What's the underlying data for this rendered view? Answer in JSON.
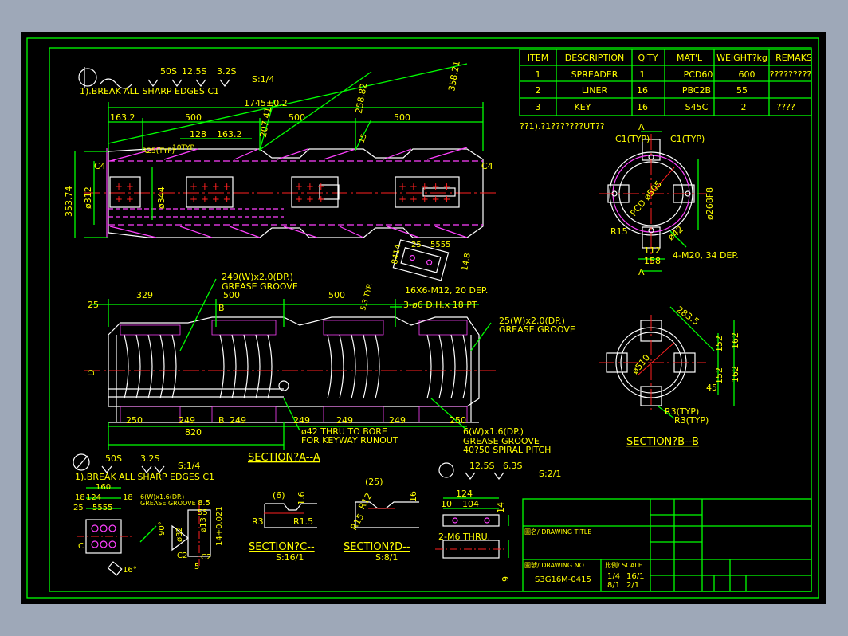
{
  "bom": {
    "headers": [
      "ITEM",
      "DESCRIPTION",
      "Q'TY",
      "MAT'L",
      "WEIGHT?kg",
      "REMAKS"
    ],
    "rows": [
      [
        "1",
        "SPREADER",
        "1",
        "PCD60",
        "600",
        "?????????"
      ],
      [
        "2",
        "LINER",
        "16",
        "PBC2B",
        "55",
        ""
      ],
      [
        "3",
        "KEY",
        "16",
        "S45C",
        "2",
        "????"
      ]
    ]
  },
  "notes": {
    "top_finish": [
      "50S",
      "12.5S",
      "3.2S"
    ],
    "top_scale": "S:1/4",
    "top_note": "1).BREAK ALL SHARP EDGES C1",
    "top_right_note": "??1).?1???????UT??",
    "bottom_finish": [
      "50S",
      "3.2S"
    ],
    "bottom_scale": "S:1/4",
    "bottom_note": "1).BREAK ALL SHARP EDGES C1",
    "key_finish": [
      "12.5S",
      "6.3S"
    ],
    "key_scale": "S:2/1"
  },
  "dims": {
    "overall": "1745±0.2",
    "d1": "163.2",
    "d2": "500",
    "d3": "500",
    "d4": "500",
    "d5": "128",
    "d6": "163.2",
    "r25": "R25(TYP)",
    "d10": "10TYP",
    "ang1": "358.21",
    "ang2": "258.82",
    "ang3": "207.41",
    "c4a": "C4",
    "c4b": "C4",
    "dia_outer": "353.74",
    "dia_312": "ø312",
    "dia_344": "ø344",
    "dia_15": "15",
    "tap": "16X6-M12, 20 DEP.",
    "k1": "25",
    "k2": "5555",
    "k3": "8414",
    "k4": "14.8",
    "groove1_a": "249(W)x2.0(DP.)",
    "groove1_b": "GREASE GROOVE",
    "groove2_a": "25(W)x2.0(DP.)",
    "groove2_b": "GREASE GROOVE",
    "groove3_a": "6(W)x1.6(DP.)",
    "groove3_b": "GREASE GROOVE",
    "groove3_c": "40?50 SPIRAL PITCH",
    "hole": "3-ø6  D.H.x 18 PT",
    "thru_a": "ø42 THRU TO BORE",
    "thru_b": "FOR KEYWAY RUNOUT",
    "s25": "25",
    "s329": "329",
    "s500a": "500",
    "s500b": "500",
    "s250a": "250",
    "s249a": "249",
    "s249b": "249",
    "s249c": "249",
    "s249d": "249",
    "s249e": "249",
    "s250b": "250",
    "s820": "820",
    "b_label": "B",
    "b_label2": "B",
    "d_label": "D",
    "sec_aa": "SECTION?A--A",
    "sec_bb": "SECTION?B--B",
    "sec_cc": "SECTION?C--",
    "sec_dd": "SECTION?D--",
    "scale_c": "S:16/1",
    "scale_d": "S:8/1",
    "c1a": "C1(TYP)",
    "c1b": "C1(TYP)",
    "a_top": "A",
    "a_bot": "A",
    "pcd": "PCD ø505",
    "r15": "R15",
    "dia_42": "ø42",
    "d112": "112",
    "d158": "158",
    "m20": "4-M20,  34 DEP.",
    "dia_268": "ø268F8",
    "b283": "283.5",
    "b152a": "152",
    "b152b": "152",
    "b162a": "162",
    "b162b": "162",
    "b45": "45",
    "r3a": "R3(TYP)",
    "r3b": "R3(TYP)",
    "bdia": "ø510",
    "c_6": "(6)",
    "c_16": "1.6",
    "c_r3": "R3",
    "c_r15": "R1.5",
    "d_25": "(25)",
    "d_r12": "R12",
    "d_r15": "R15",
    "d_16": "16",
    "key_124": "124",
    "key_10": "10",
    "key_104": "104",
    "key_14": "14",
    "key_m6": "2-M6 THRU.",
    "key_9": "9",
    "l160": "160",
    "l18a": "18",
    "l124": "124",
    "l18b": "18",
    "l25": "25",
    "l5555": "5555",
    "l_groove": "6(W)x1.6(DP.)",
    "l_groove2": "GREASE GROOVE",
    "l_90": "90°",
    "l_32": "ø32",
    "l_13": "ø13",
    "l_14": "14+0.021",
    "l_85": "8.5",
    "l_55": "55",
    "l_16": "16°",
    "l_c2a": "C2",
    "l_c2b": "C2",
    "l_5": "5",
    "l_c": "C"
  },
  "title_block": {
    "drawing_title_label": "圖名/ DRAWING TITLE",
    "drawing_no_label": "圖號/ DRAWING NO.",
    "drawing_no": "S3G16M-0415",
    "scale_label": "比例/ SCALE",
    "scales": [
      "1/4",
      "16/1",
      "8/1",
      "2/1"
    ]
  }
}
